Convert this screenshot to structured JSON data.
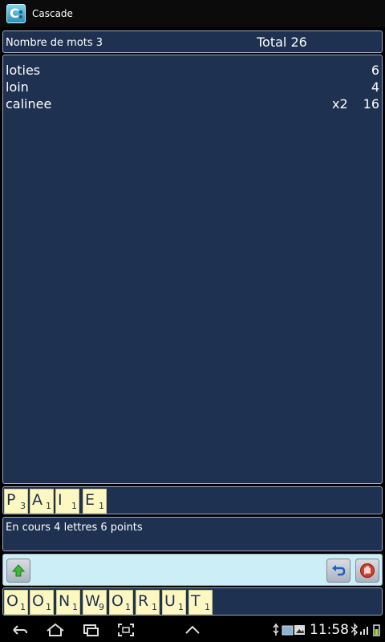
{
  "app": {
    "title": "Cascade"
  },
  "header": {
    "count_text": "Nombre de mots 3",
    "total_text": "Total 26"
  },
  "words": [
    {
      "word": "loties",
      "multiplier": "",
      "points": "6"
    },
    {
      "word": "loin",
      "multiplier": "",
      "points": "4"
    },
    {
      "word": "calinee",
      "multiplier": "x2",
      "points": "16"
    }
  ],
  "current_tiles": [
    {
      "letter": "P",
      "value": "3"
    },
    {
      "letter": "A",
      "value": "1"
    },
    {
      "letter": "I",
      "value": "1"
    },
    {
      "letter": "E",
      "value": "1"
    }
  ],
  "status": {
    "text": "En cours 4 lettres 6 points"
  },
  "rack_tiles": [
    {
      "letter": "O",
      "value": "1"
    },
    {
      "letter": "O",
      "value": "1"
    },
    {
      "letter": "N",
      "value": "1"
    },
    {
      "letter": "W",
      "value": "9"
    },
    {
      "letter": "O",
      "value": "1"
    },
    {
      "letter": "R",
      "value": "1"
    },
    {
      "letter": "U",
      "value": "1"
    },
    {
      "letter": "T",
      "value": "1"
    }
  ],
  "system": {
    "time": "11:58"
  },
  "colors": {
    "panel": "#1e3150",
    "tile": "#fdf8c2",
    "toolbar": "#cbeef7"
  }
}
